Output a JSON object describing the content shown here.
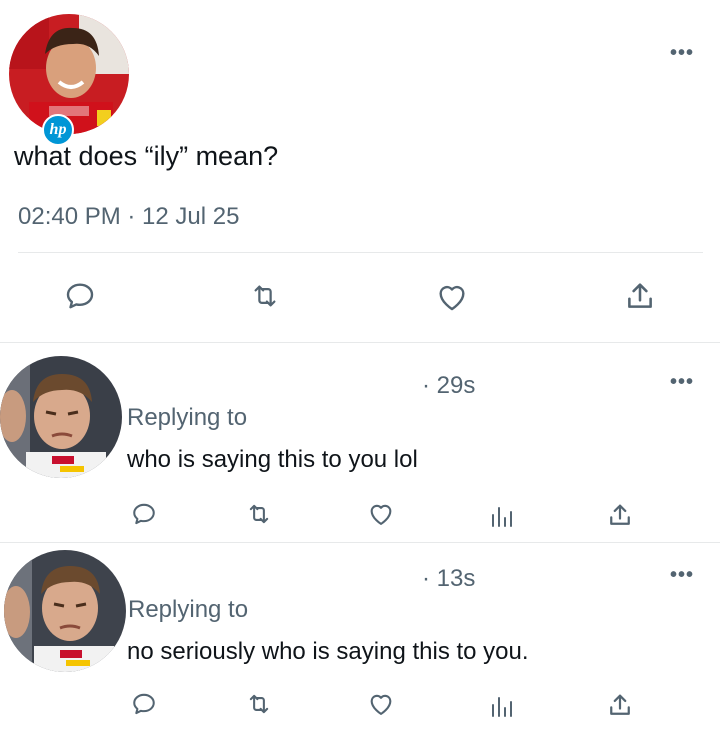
{
  "main_tweet": {
    "avatar_badge": "hp",
    "text": "what does “ily” mean?",
    "timestamp": "02:40 PM · 12 Jul 25",
    "more": "•••"
  },
  "replies": [
    {
      "time": "· 29s",
      "replying_label": "Replying to",
      "text": "who is saying this to you lol",
      "more": "•••"
    },
    {
      "time": "· 13s",
      "replying_label": "Replying to",
      "text": "no seriously who is saying this to you.",
      "more": "•••"
    }
  ],
  "icons": {
    "reply": "reply-icon",
    "retweet": "retweet-icon",
    "like": "like-icon",
    "views": "views-icon",
    "share": "share-icon"
  },
  "colors": {
    "text": "#0f1419",
    "muted": "#536471",
    "divider": "#e7e9ea",
    "racing_red": "#d0111b"
  }
}
